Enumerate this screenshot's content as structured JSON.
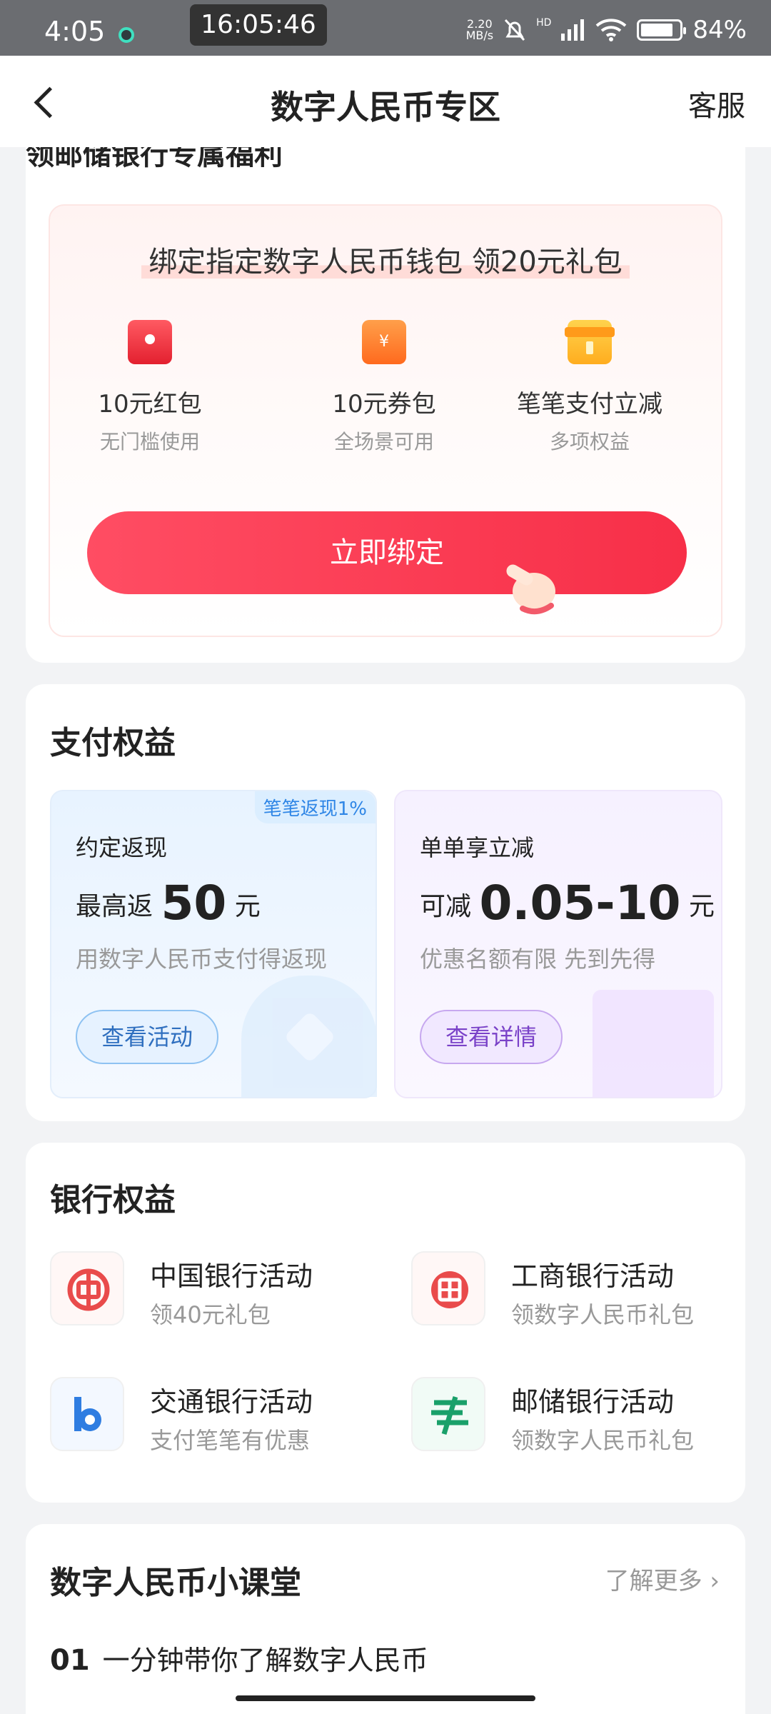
{
  "status_bar": {
    "time": "4:05",
    "clock": "16:05:46",
    "net_speed": "2.20\nMB/s",
    "signal": "HD",
    "battery": "84%",
    "battery_level": 0.84
  },
  "header": {
    "title": "数字人民币专区",
    "service": "客服"
  },
  "promo": {
    "section_title": "领邮储银行专属福利",
    "headline": "绑定指定数字人民币钱包 领20元礼包",
    "benefits": [
      {
        "icon": "red-packet-icon",
        "name": "10元红包",
        "sub": "无门槛使用"
      },
      {
        "icon": "coupon-icon",
        "name": "10元券包",
        "sub": "全场景可用"
      },
      {
        "icon": "gift-box-icon",
        "name": "笔笔支付立减",
        "sub": "多项权益"
      }
    ],
    "bind_button": "立即绑定"
  },
  "payment": {
    "title": "支付权益",
    "cards": [
      {
        "tag": "笔笔返现1%",
        "head": "约定返现",
        "prefix": "最高返",
        "amount": "50",
        "unit": "元",
        "desc": "用数字人民币支付得返现",
        "button": "查看活动"
      },
      {
        "head": "单单享立减",
        "prefix": "可减",
        "amount": "0.05-10",
        "unit": "元",
        "desc": "优惠名额有限 先到先得",
        "button": "查看详情"
      }
    ]
  },
  "banks": {
    "title": "银行权益",
    "items": [
      {
        "name": "中国银行活动",
        "sub": "领40元礼包",
        "color": "#e94b4b"
      },
      {
        "name": "工商银行活动",
        "sub": "领数字人民币礼包",
        "color": "#e94b4b"
      },
      {
        "name": "交通银行活动",
        "sub": "支付笔笔有优惠",
        "color": "#2f7de1"
      },
      {
        "name": "邮储银行活动",
        "sub": "领数字人民币礼包",
        "color": "#1aa06a"
      }
    ]
  },
  "classroom": {
    "title": "数字人民币小课堂",
    "more": "了解更多",
    "lesson_no": "01",
    "lesson": "一分钟带你了解数字人民币"
  }
}
